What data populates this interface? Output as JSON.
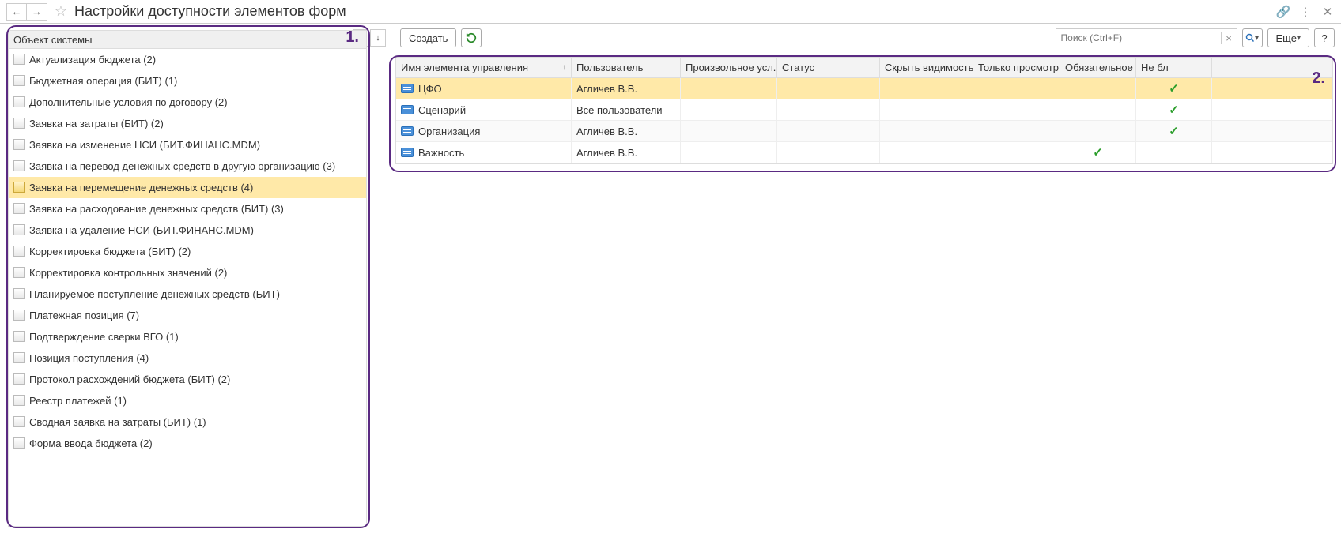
{
  "title": "Настройки доступности элементов форм",
  "left_annotation": "1.",
  "right_annotation": "2.",
  "toolbar": {
    "create_label": "Создать",
    "more_label": "Еще",
    "help_label": "?",
    "search_placeholder": "Поиск (Ctrl+F)"
  },
  "tree": {
    "header": "Объект системы",
    "items": [
      {
        "label": "Актуализация бюджета (2)"
      },
      {
        "label": "Бюджетная операция (БИТ) (1)"
      },
      {
        "label": "Дополнительные условия по договору (2)"
      },
      {
        "label": "Заявка на затраты (БИТ) (2)"
      },
      {
        "label": "Заявка на изменение НСИ (БИТ.ФИНАНС.MDM)"
      },
      {
        "label": "Заявка на перевод денежных средств в другую организацию (3)"
      },
      {
        "label": "Заявка на перемещение денежных средств (4)",
        "selected": true
      },
      {
        "label": "Заявка на расходование денежных средств (БИТ) (3)"
      },
      {
        "label": "Заявка на удаление НСИ (БИТ.ФИНАНС.MDM)"
      },
      {
        "label": "Корректировка бюджета (БИТ) (2)"
      },
      {
        "label": "Корректировка контрольных значений (2)"
      },
      {
        "label": "Планируемое поступление денежных средств (БИТ)"
      },
      {
        "label": "Платежная позиция (7)"
      },
      {
        "label": "Подтверждение сверки ВГО (1)"
      },
      {
        "label": "Позиция поступления (4)"
      },
      {
        "label": "Протокол расхождений бюджета (БИТ) (2)"
      },
      {
        "label": "Реестр платежей (1)"
      },
      {
        "label": "Сводная заявка на затраты (БИТ) (1)"
      },
      {
        "label": "Форма ввода бюджета (2)"
      }
    ]
  },
  "grid": {
    "columns": {
      "c1": "Имя элемента управления",
      "c2": "Пользователь",
      "c3": "Произвольное усл...",
      "c4": "Статус",
      "c5": "Скрыть видимость",
      "c6": "Только просмотр",
      "c7": "Обязательное",
      "c8": "Не бл"
    },
    "rows": [
      {
        "name": "ЦФО",
        "user": "Агличев В.В.",
        "cond": "",
        "status": "",
        "hide": "",
        "readonly": "",
        "required": "",
        "noblock": "✓",
        "selected": true
      },
      {
        "name": "Сценарий",
        "user": "Все пользователи",
        "cond": "",
        "status": "",
        "hide": "",
        "readonly": "",
        "required": "",
        "noblock": "✓"
      },
      {
        "name": "Организация",
        "user": "Агличев В.В.",
        "cond": "",
        "status": "",
        "hide": "",
        "readonly": "",
        "required": "",
        "noblock": "✓"
      },
      {
        "name": "Важность",
        "user": "Агличев В.В.",
        "cond": "",
        "status": "",
        "hide": "",
        "readonly": "",
        "required": "✓",
        "noblock": ""
      }
    ]
  }
}
